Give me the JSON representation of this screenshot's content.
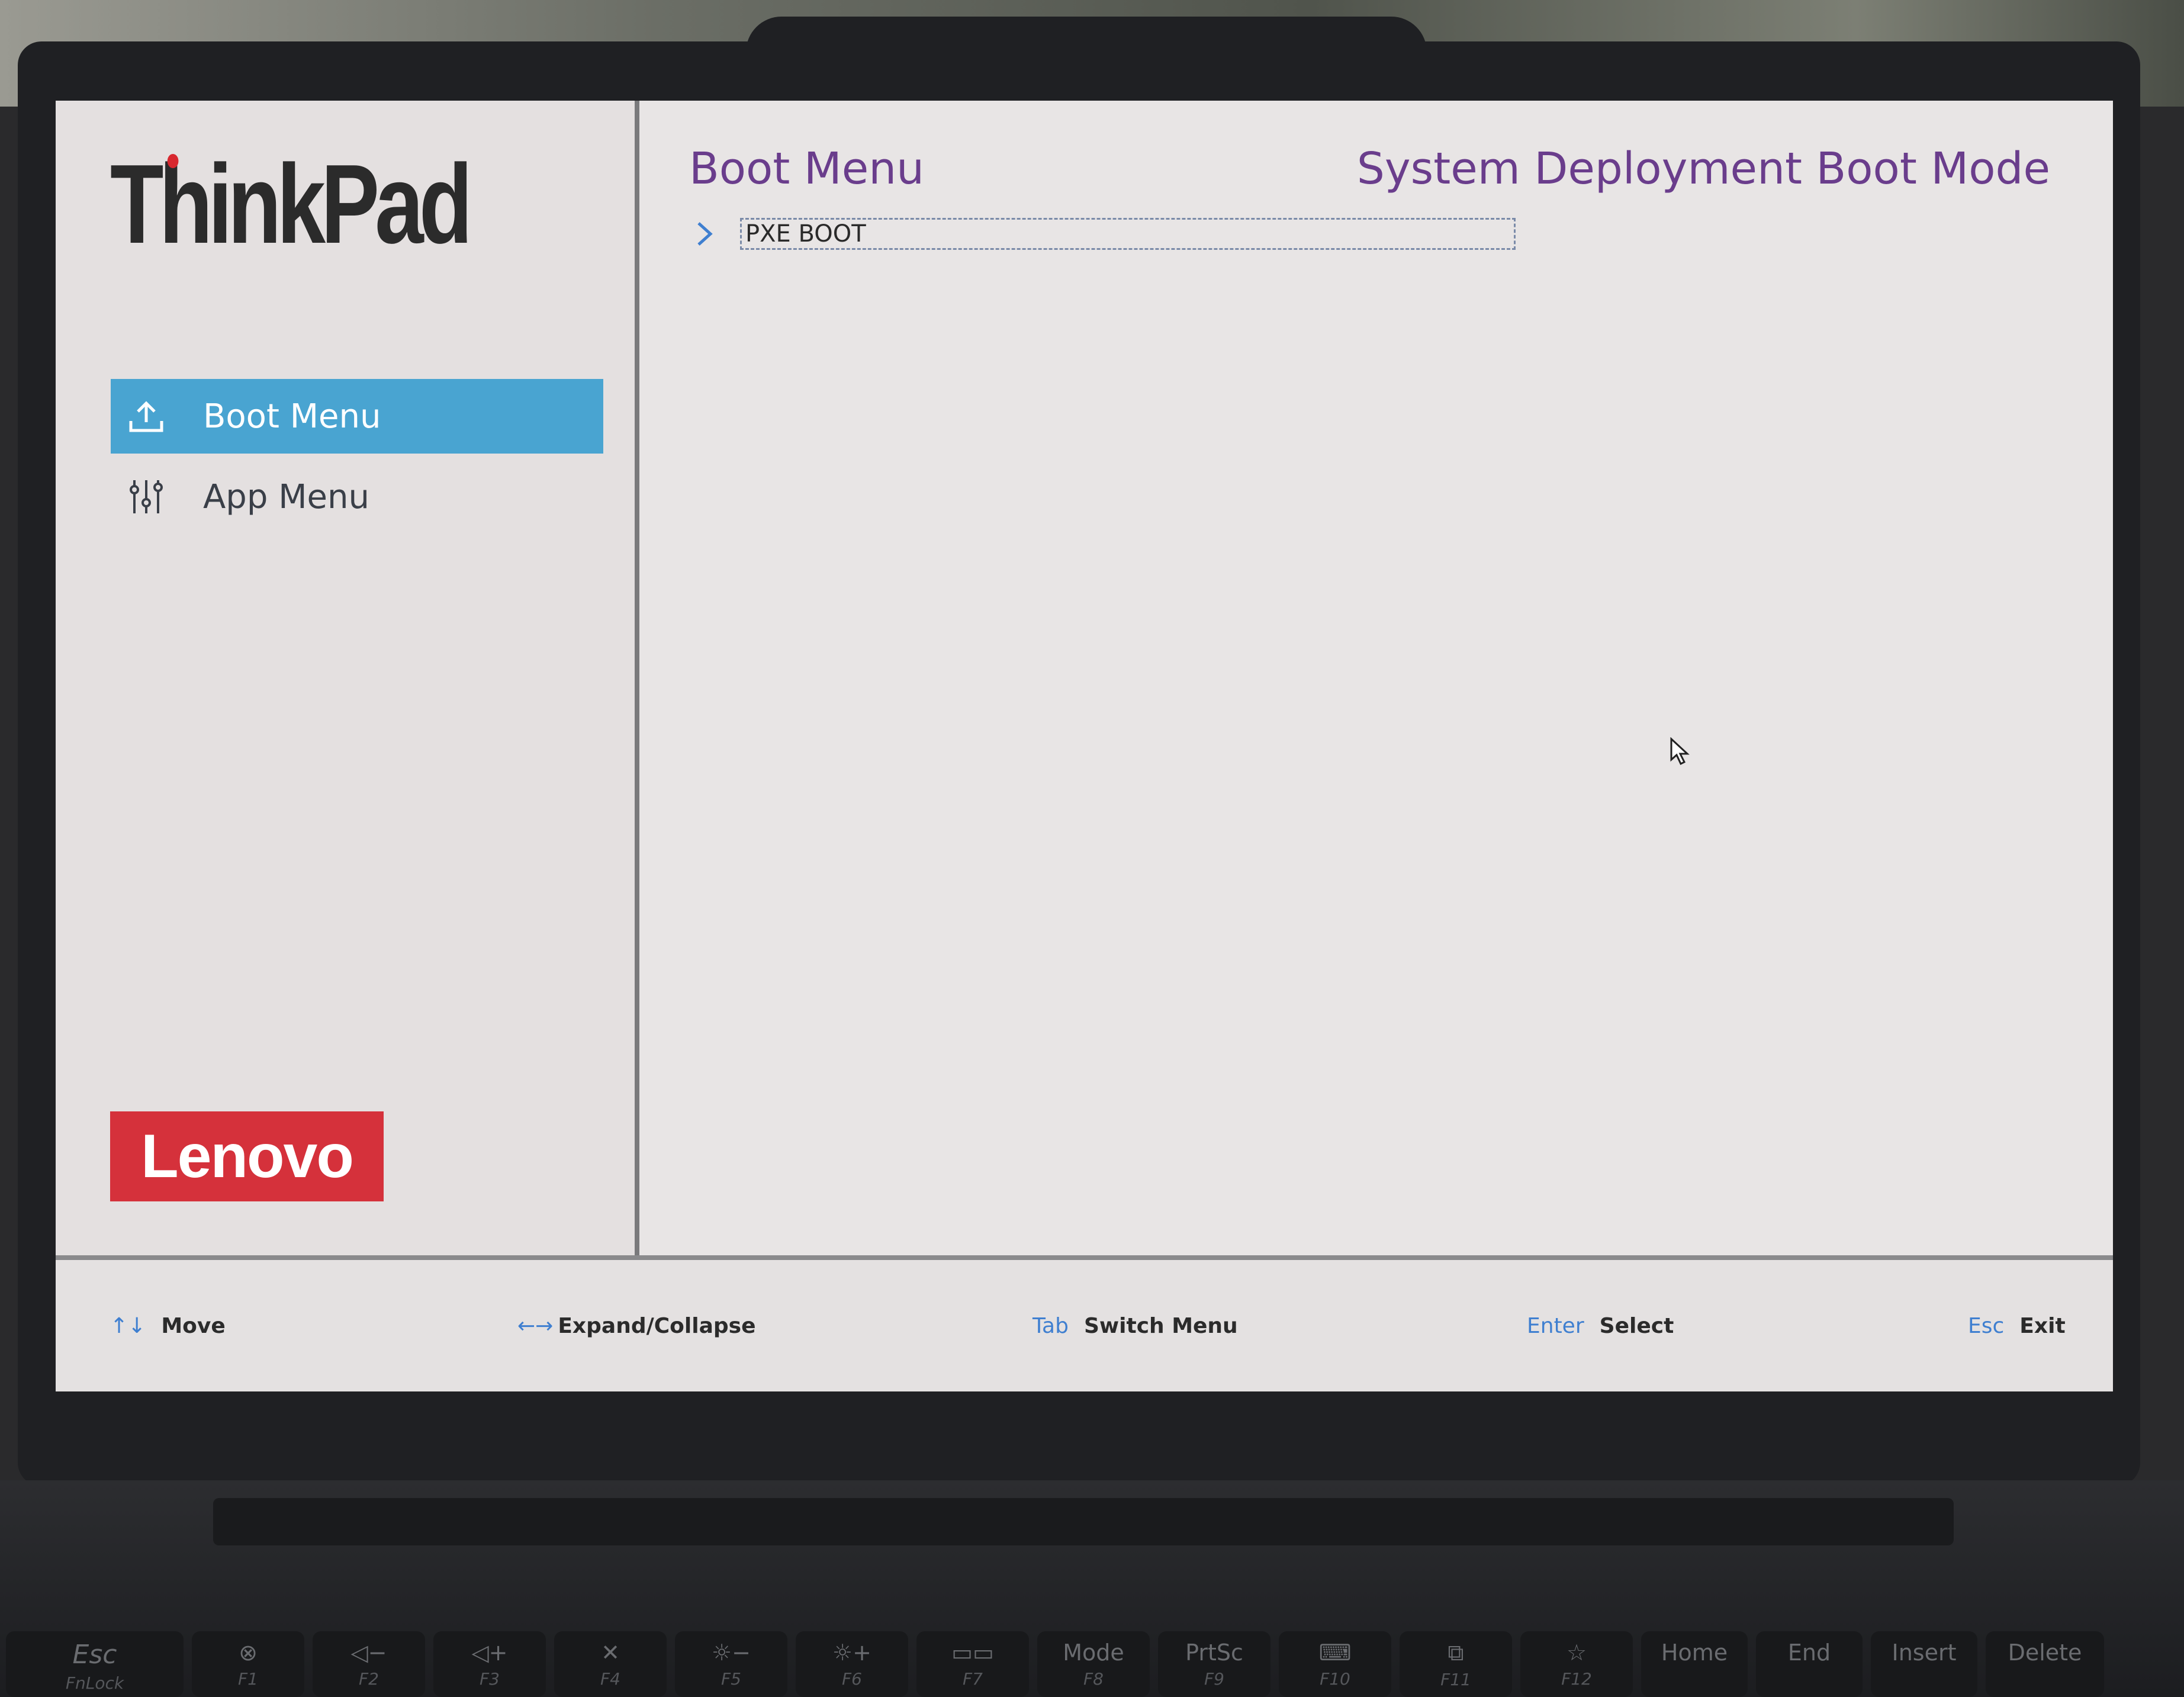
{
  "brand": {
    "product": "ThinkPad",
    "maker": "Lenovo"
  },
  "sidebar": {
    "items": [
      {
        "label": "Boot Menu",
        "icon": "upload-icon",
        "selected": true
      },
      {
        "label": "App Menu",
        "icon": "sliders-icon",
        "selected": false
      }
    ]
  },
  "main": {
    "title": "Boot Menu",
    "mode": "System Deployment Boot Mode",
    "entries": [
      {
        "label": "PXE BOOT"
      }
    ]
  },
  "footer": {
    "move": {
      "key": "↑↓",
      "label": "Move"
    },
    "expand": {
      "key": "←→",
      "label": "Expand/Collapse"
    },
    "tab": {
      "key": "Tab",
      "label": "Switch Menu"
    },
    "enter": {
      "key": "Enter",
      "label": "Select"
    },
    "esc": {
      "key": "Esc",
      "label": "Exit"
    }
  },
  "keyboard": {
    "keys": [
      {
        "top": "Esc",
        "sub": "FnLock"
      },
      {
        "top": "⊗",
        "sub": "F1"
      },
      {
        "top": "◁−",
        "sub": "F2"
      },
      {
        "top": "◁+",
        "sub": "F3"
      },
      {
        "top": "✕",
        "sub": "F4"
      },
      {
        "top": "☼−",
        "sub": "F5"
      },
      {
        "top": "☼+",
        "sub": "F6"
      },
      {
        "top": "▭▭",
        "sub": "F7"
      },
      {
        "top": "Mode",
        "sub": "F8"
      },
      {
        "top": "PrtSc",
        "sub": "F9"
      },
      {
        "top": "⌨",
        "sub": "F10"
      },
      {
        "top": "⧉",
        "sub": "F11"
      },
      {
        "top": "☆",
        "sub": "F12"
      },
      {
        "top": "Home",
        "sub": ""
      },
      {
        "top": "End",
        "sub": ""
      },
      {
        "top": "Insert",
        "sub": ""
      },
      {
        "top": "Delete",
        "sub": ""
      }
    ]
  },
  "colors": {
    "selection": "#49a4d1",
    "title": "#6a3d8c",
    "key_hint": "#3f7fd0",
    "lenovo_red": "#d5313b"
  }
}
